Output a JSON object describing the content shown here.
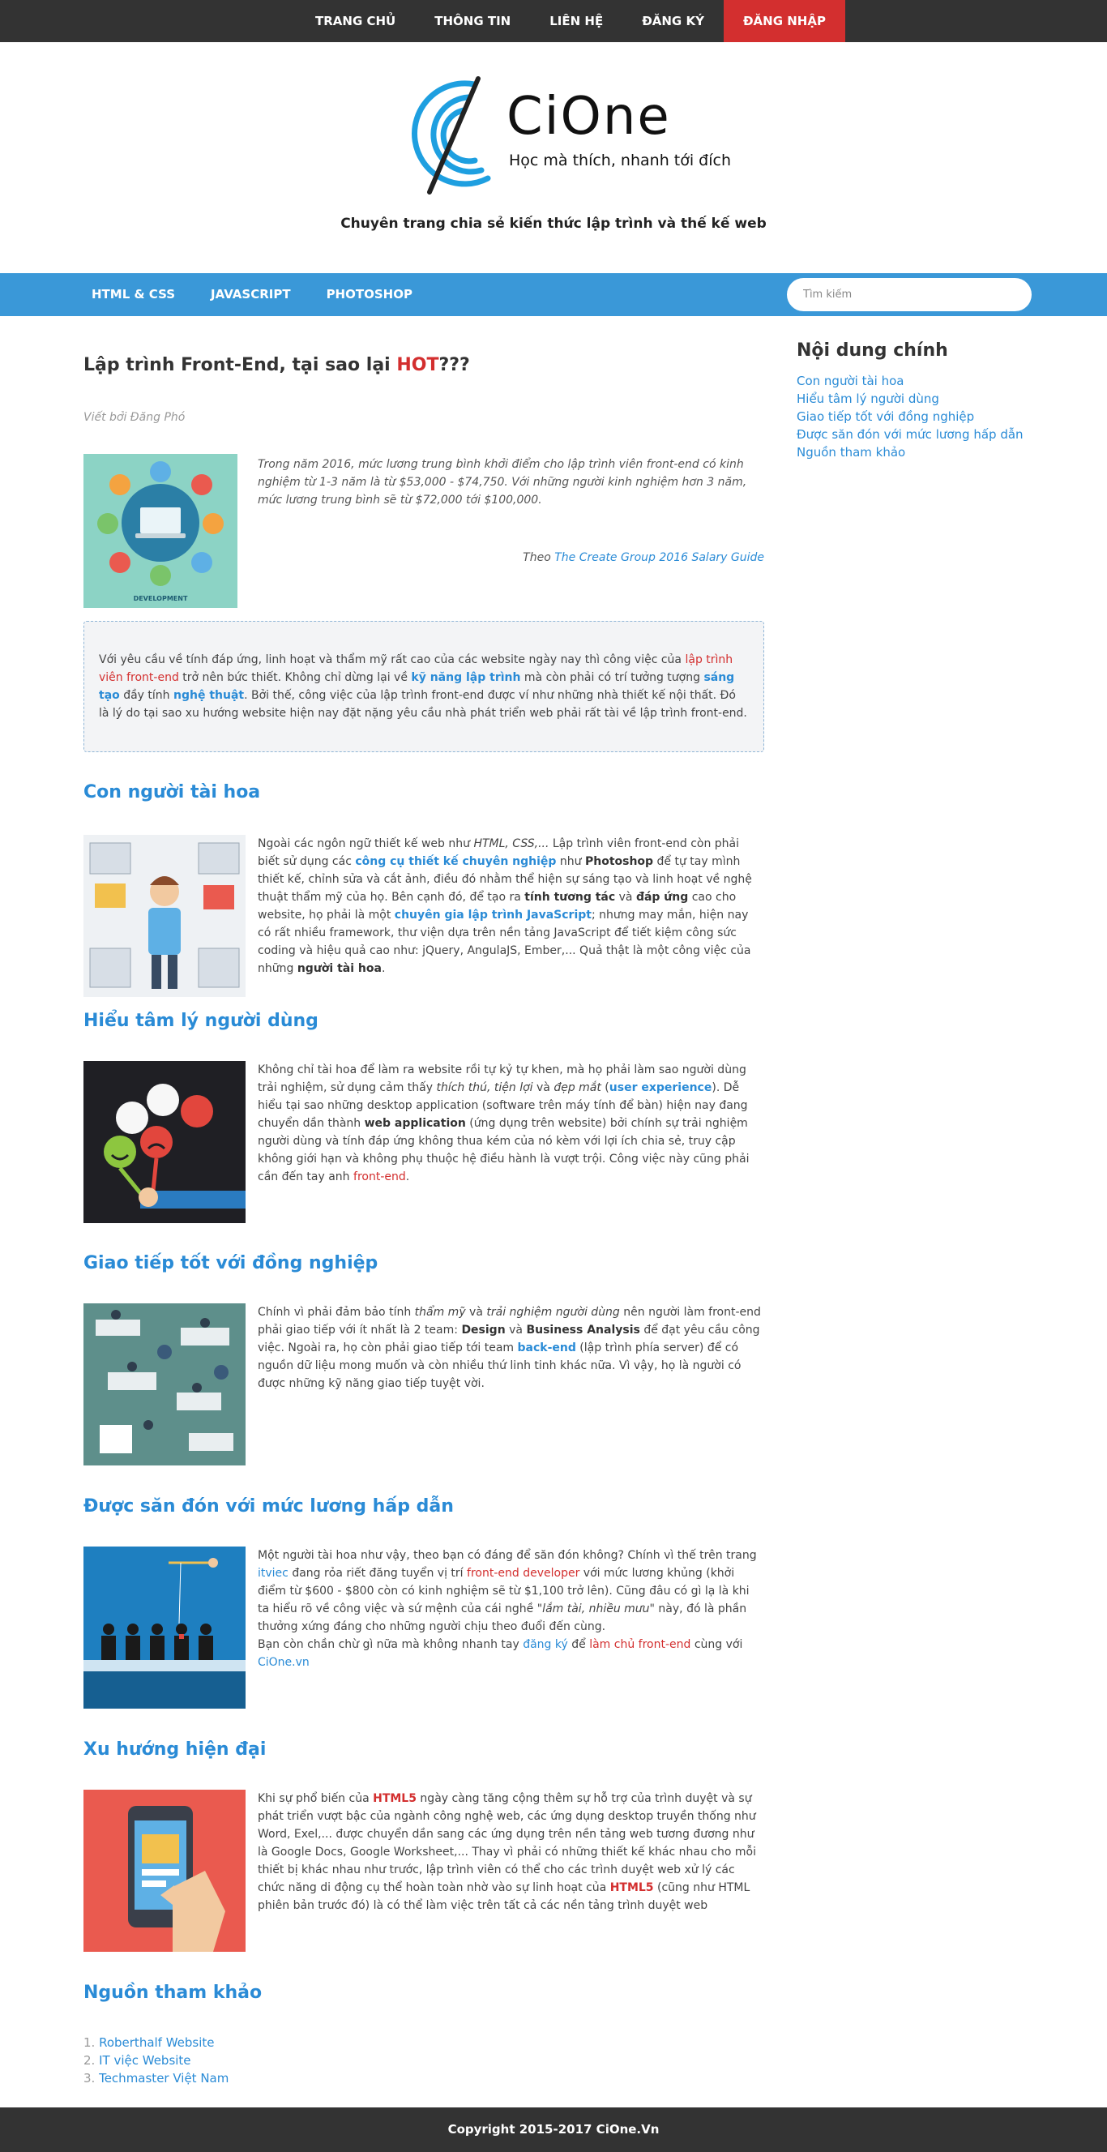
{
  "topnav": {
    "items": [
      "TRANG CHỦ",
      "THÔNG TIN",
      "LIÊN HỆ",
      "ĐĂNG KÝ",
      "ĐĂNG NHẬP"
    ]
  },
  "header": {
    "logo_text": "CiOne",
    "logo_tagline": "Học mà thích, nhanh tới đích",
    "site_description": "Chuyên trang chia sẻ kiến thức lập trình và thế kế web"
  },
  "catbar": {
    "items": [
      "HTML & CSS",
      "JAVASCRIPT",
      "PHOTOSHOP"
    ],
    "search_placeholder": "Tìm kiếm"
  },
  "article": {
    "title_main": "Lập trình Front-End, tại sao lại ",
    "title_hot": "HOT",
    "title_suffix": "???",
    "byline": "Viết bởi Đăng Phó",
    "intro_image_caption": "DEVELOPMENT",
    "intro_quote": "Trong năm 2016, mức lương trung bình khởi điểm cho lập trình viên front-end có kinh nghiệm từ 1-3 năm là từ $53,000 - $74,750. Với những người kinh nghiệm hơn 3 năm, mức lương trung bình sẽ từ $72,000 tới $100,000.",
    "intro_source_prefix": "Theo ",
    "intro_source_link": "The Create Group 2016 Salary Guide",
    "callout": {
      "p1": "Với yêu cầu về tính đáp ứng, linh hoạt và thẩm mỹ rất cao của các website ngày nay thì công việc của ",
      "link1": "lập trình viên front-end",
      "p2": " trở nên bức thiết. Không chỉ dừng lại về ",
      "kw1": "kỹ năng lập trình",
      "p3": " mà còn phải có trí tưởng tượng ",
      "kw2": "sáng tạo",
      "p4": " đầy tính ",
      "kw3": "nghệ thuật",
      "p5": ". Bởi thế, công việc của lập trình front-end được ví như những nhà thiết kế nội thất. Đó là lý do tại sao xu hướng website hiện nay đặt nặng yêu cầu nhà phát triển web phải rất tài về lập trình front-end."
    },
    "sections": {
      "talent": {
        "title": "Con người tài hoa",
        "t1": "Ngoài các ngôn ngữ thiết kế web như ",
        "t1i": "HTML, CSS,...",
        "t2": " Lập trình viên front-end còn phải biết sử dụng các ",
        "k1": "công cụ thiết kế chuyên nghiệp",
        "t3": " như ",
        "k2": "Photoshop",
        "t4": " để tự tay mình thiết kế, chỉnh sửa và cắt ảnh, điều đó nhằm thể hiện sự sáng tạo và linh hoạt về nghệ thuật thẩm mỹ của họ. Bên cạnh đó, để tạo ra ",
        "k3": "tính tương tác",
        "t5": " và ",
        "k4": "đáp ứng",
        "t6": " cao cho website, họ phải là một ",
        "k5": "chuyên gia lập trình JavaScript",
        "t7": "; nhưng may mắn, hiện nay có rất nhiều framework, thư viện dựa trên nền tảng JavaScript để tiết kiệm công sức coding và hiệu quả cao như: jQuery, AngulaJS, Ember,... Quả thật là một công việc của những ",
        "k6": "người tài hoa",
        "t8": "."
      },
      "psychology": {
        "title": "Hiểu tâm lý người dùng",
        "t1": "Không chỉ tài hoa để làm ra website rồi tự kỷ tự khen, mà họ phải làm sao người dùng trải nghiệm, sử dụng cảm thấy ",
        "t1i": "thích thú, tiện lợi",
        "t2": " và ",
        "t2i": "đẹp mắt",
        "t3": " (",
        "k1": "user experience",
        "t4": "). Dễ hiểu tại sao những desktop application (software trên máy tính để bàn) hiện nay đang chuyển dần thành ",
        "k2": "web application",
        "t5": " (ứng dụng trên website) bởi chính sự trải nghiệm người dùng và tính đáp ứng không thua kém của nó kèm với lợi ích chia sẻ, truy cập không giới hạn và không phụ thuộc hệ điều hành là vượt trội. Công việc này cũng phải cần đến tay anh ",
        "link": "front-end",
        "t6": "."
      },
      "communication": {
        "title": "Giao tiếp tốt với đồng nghiệp",
        "t1": "Chính vì phải đảm bảo tính ",
        "t1i": "thẩm mỹ",
        "t2": " và ",
        "t2i": "trải nghiệm người dùng",
        "t3": " nên người làm front-end phải giao tiếp với ít nhất là 2 team: ",
        "k1": "Design",
        "t4": " và ",
        "k2": "Business Analysis",
        "t5": " để đạt yêu cầu công việc. Ngoài ra, họ còn phải giao tiếp tới team ",
        "k3": "back-end",
        "t6": " (lập trình phía server) để có nguồn dữ liệu mong muốn và còn nhiều thứ linh tinh khác nữa. Vì vậy, họ là người có được những kỹ năng giao tiếp tuyệt vời."
      },
      "salary": {
        "title": "Được săn đón với mức lương hấp dẫn",
        "t1": "Một người tài hoa như vậy, theo bạn có đáng để săn đón không? Chính vì thế trên trang ",
        "l1": "itviec",
        "t2": " đang rỏa riết đăng tuyển vị trí ",
        "l2": "front-end developer",
        "t3": " với mức lương khủng (khởi điểm từ $600 - $800 còn có kinh nghiệm sẽ từ $1,100 trở lên). Cũng đâu có gì lạ là khi ta hiểu rõ về công việc và sứ mệnh của cái nghề ",
        "t3i": "\"lắm tài, nhiều mưu\"",
        "t4": " này, đó là phần thưởng xứng đáng cho những người chịu theo đuổi đến cùng.",
        "t5": "Bạn còn chần chừ gì nữa mà không nhanh tay ",
        "l3": "đăng ký",
        "t6": " để ",
        "l4": "làm chủ front-end",
        "t7": " cùng với ",
        "l5": "CiOne.vn"
      },
      "trend": {
        "title": "Xu hướng hiện đại",
        "t1": "Khi sự phổ biến của ",
        "k1": "HTML5",
        "t2": " ngày càng tăng cộng thêm sự hỗ trợ của trình duyệt và sự phát triển vượt bậc của ngành công nghệ web, các ứng dụng desktop truyền thống như Word, Exel,... được chuyển dần sang các ứng dụng trên nền tảng web tương đương như là Google Docs, Google Worksheet,... Thay vì phải có những thiết kế khác nhau cho mỗi thiết bị khác nhau như trước, lập trình viên có thể cho các trình duyệt web xử lý các chức năng di động cụ thể hoàn toàn nhờ vào sự linh hoạt của ",
        "k2": "HTML5",
        "t3": " (cũng như HTML phiên bản trước đó) là có thể làm việc trên tất cả các nền tảng trình duyệt web"
      },
      "references": {
        "title": "Nguồn tham khảo",
        "items": [
          "Roberthalf Website",
          "IT việc Website",
          "Techmaster Việt Nam"
        ]
      }
    }
  },
  "sidebar": {
    "title": "Nội dung chính",
    "links": [
      "Con người tài hoa",
      "Hiểu tâm lý người dùng",
      "Giao tiếp tốt với đồng nghiệp",
      "Được săn đón với mức lương hấp dẫn",
      "Nguồn tham khảo"
    ]
  },
  "footer": {
    "text": "Copyright 2015-2017 CiOne.Vn"
  },
  "colors": {
    "dark_bar": "#333333",
    "active_red": "#d32f2f",
    "blue_bar": "#3a98d8",
    "link_blue": "#2a8bd6",
    "logo_blue": "#1e9fe0"
  }
}
